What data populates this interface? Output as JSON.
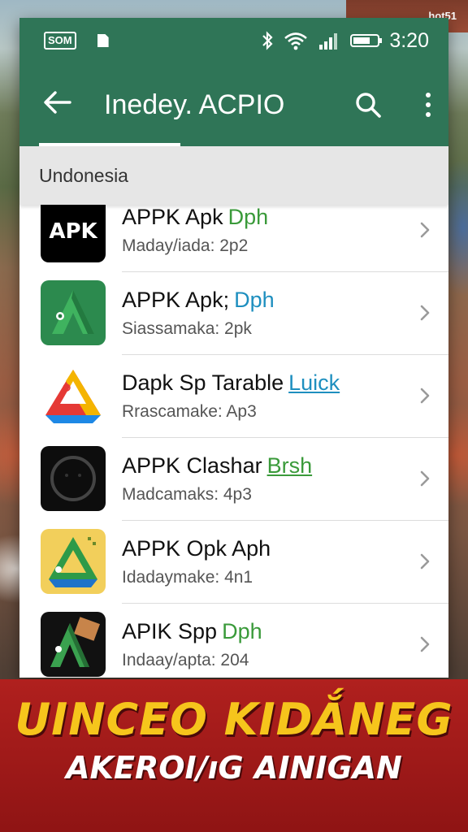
{
  "watermark": "hot51",
  "status_bar": {
    "sim_label": "SOM",
    "time": "3:20",
    "battery_level": 0.7
  },
  "app_bar": {
    "title": "Inedey. ACPIO",
    "icons": [
      "back-arrow-icon",
      "search-icon",
      "more-vert-icon"
    ]
  },
  "section_header": "Undonesia",
  "apps": [
    {
      "name": "APPK Apk",
      "tag": "Dph",
      "tag_color": "#3a9a3a",
      "tag_underline": false,
      "subtitle": "Maday/iada: 2p2",
      "icon": "apk-black-icon"
    },
    {
      "name": "APPK Apk;",
      "tag": "Dph",
      "tag_color": "#1e8fbf",
      "tag_underline": false,
      "subtitle": "Siassamaka: 2pk",
      "icon": "green-a-icon"
    },
    {
      "name": "Dapk Sp Tarable",
      "tag": "Luick",
      "tag_color": "#1e8fbf",
      "tag_underline": true,
      "subtitle": "Rrascamake: Ap3",
      "icon": "drive-triangle-icon"
    },
    {
      "name": "APPK Clashar",
      "tag": "Brsh",
      "tag_color": "#3a9a3a",
      "tag_underline": true,
      "subtitle": "Madcamaks: 4p3",
      "icon": "circle-face-icon"
    },
    {
      "name": "APPK Opk Aph",
      "tag": "",
      "tag_color": "#3a9a3a",
      "tag_underline": false,
      "subtitle": "Idadaymake: 4n1",
      "icon": "yellow-drive-icon"
    },
    {
      "name": "APIK Spp",
      "tag": "Dph",
      "tag_color": "#3a9a3a",
      "tag_underline": false,
      "subtitle": "Indaay/apta: 204",
      "icon": "dark-a-icon"
    }
  ],
  "banner": {
    "line1": "UINCEO KIDẮNEG",
    "line2": "AKEROI/ıG AINIGAN"
  },
  "colors": {
    "app_bar": "#2f7557",
    "banner_bg": "#a81b1b",
    "banner_headline": "#f6c51c"
  }
}
